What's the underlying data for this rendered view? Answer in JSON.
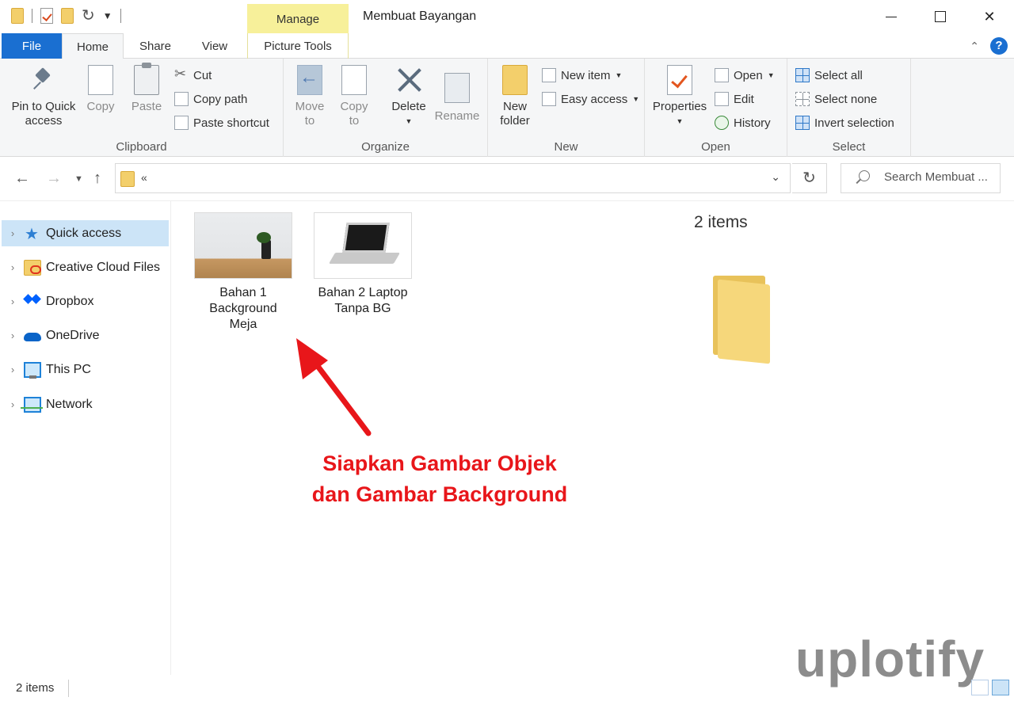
{
  "window": {
    "title": "Membuat Bayangan",
    "contextual_tab_group": "Manage"
  },
  "tabs": {
    "file": "File",
    "home": "Home",
    "share": "Share",
    "view": "View",
    "picture_tools": "Picture Tools"
  },
  "ribbon": {
    "clipboard": {
      "label": "Clipboard",
      "pin": "Pin to Quick access",
      "copy": "Copy",
      "paste": "Paste",
      "cut": "Cut",
      "copy_path": "Copy path",
      "paste_shortcut": "Paste shortcut"
    },
    "organize": {
      "label": "Organize",
      "move_to": "Move to",
      "copy_to": "Copy to",
      "delete": "Delete",
      "rename": "Rename"
    },
    "new": {
      "label": "New",
      "new_folder": "New folder",
      "new_item": "New item",
      "easy_access": "Easy access"
    },
    "open": {
      "label": "Open",
      "properties": "Properties",
      "open": "Open",
      "edit": "Edit",
      "history": "History"
    },
    "select": {
      "label": "Select",
      "select_all": "Select all",
      "select_none": "Select none",
      "invert_selection": "Invert selection"
    }
  },
  "address": {
    "breadcrumb_overflow": "«"
  },
  "search": {
    "placeholder": "Search Membuat ..."
  },
  "nav_pane": {
    "items": [
      {
        "label": "Quick access",
        "icon": "star-icon",
        "selected": true
      },
      {
        "label": "Creative Cloud Files",
        "icon": "creative-cloud-folder-icon",
        "selected": false
      },
      {
        "label": "Dropbox",
        "icon": "dropbox-icon",
        "selected": false
      },
      {
        "label": "OneDrive",
        "icon": "onedrive-cloud-icon",
        "selected": false
      },
      {
        "label": "This PC",
        "icon": "computer-icon",
        "selected": false
      },
      {
        "label": "Network",
        "icon": "network-icon",
        "selected": false
      }
    ]
  },
  "files": [
    {
      "name": "Bahan 1 Background Meja",
      "thumbnail": "desk-background-thumbnail"
    },
    {
      "name": "Bahan 2 Laptop Tanpa BG",
      "thumbnail": "laptop-thumbnail"
    }
  ],
  "preview": {
    "item_count": "2 items"
  },
  "annotation": {
    "line1": "Siapkan Gambar Objek",
    "line2": "dan Gambar Background",
    "color": "#e8161a"
  },
  "watermark": {
    "text": "uplotify",
    "accent_color": "#2fa6e0"
  },
  "status": {
    "item_count": "2 items"
  },
  "colors": {
    "file_tab": "#1a6fd1",
    "manage_tab": "#f7f09a",
    "selection": "#cce4f7"
  }
}
